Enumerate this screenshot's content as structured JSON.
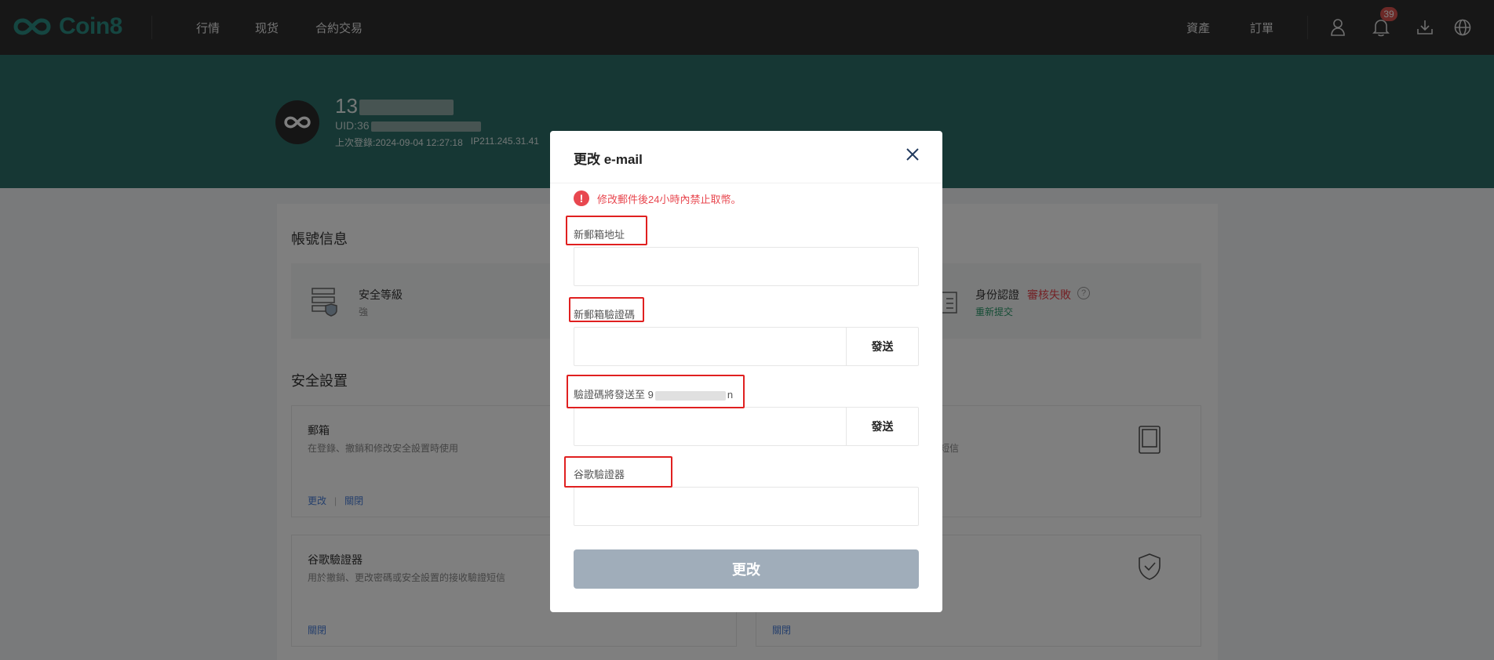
{
  "nav": {
    "brand": "Coin8",
    "links": [
      "行情",
      "现货",
      "合約交易"
    ],
    "right_links": [
      "資產",
      "訂單"
    ],
    "notification_count": "39",
    "icons": [
      "user-icon",
      "bell-icon",
      "download-icon",
      "globe-icon"
    ]
  },
  "profile": {
    "name_prefix": "13",
    "uid_prefix": "UID:36",
    "last_login_label": "上次登錄:",
    "last_login_time": "2024-09-04 12:27:18",
    "ip": "IP211.245.31.41"
  },
  "account": {
    "title": "帳號信息",
    "security_level_label": "安全等級",
    "security_level_value": "強",
    "identity_label": "身份認證",
    "identity_status": "審核失敗",
    "identity_action": "重新提交"
  },
  "security": {
    "title": "安全設置",
    "email_card": {
      "title": "郵箱",
      "desc": "在登錄、撤銷和修改安全設置時使用",
      "link_change": "更改",
      "link_close": "關閉"
    },
    "phone_card": {
      "desc_tail": "短信"
    },
    "google_card": {
      "title": "谷歌驗證器",
      "desc": "用於撤銷、更改密碼或安全設置的接收驗證短信",
      "link_close": "關閉"
    },
    "right_bottom_card": {
      "link": "關閉"
    }
  },
  "modal": {
    "title": "更改 e-mail",
    "warning": "修改郵件後24小時內禁止取幣。",
    "new_email_label": "新郵箱地址",
    "new_email_code_label": "新郵箱驗證碼",
    "send_label": "發送",
    "code_sent_label_prefix": "驗證碼將發送至 9",
    "code_sent_label_suffix": "n",
    "google_auth_label": "谷歌驗證器",
    "submit_label": "更改",
    "new_email_value": "",
    "new_email_code_value": "",
    "current_email_code_value": "",
    "google_code_value": ""
  },
  "colors": {
    "nav_bg": "#2f2f2f",
    "brand": "#2b8c82",
    "banner_bg": "#2c6e68",
    "warning": "#e8474f",
    "highlight": "#e02020",
    "submit_disabled": "#a0adba",
    "link": "#4a7fd9"
  }
}
